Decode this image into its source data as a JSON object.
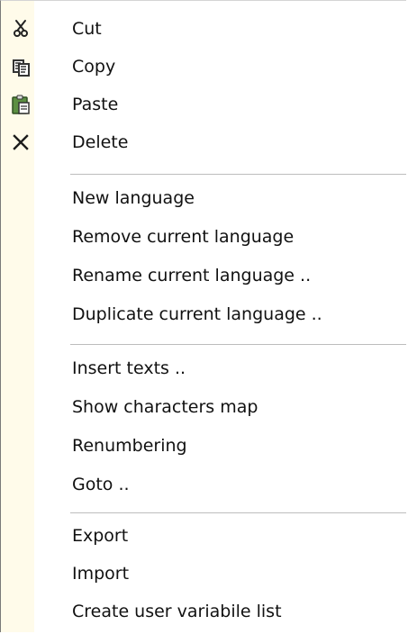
{
  "menu": {
    "groups": [
      {
        "items": [
          {
            "label": "Cut",
            "icon": "scissors-icon"
          },
          {
            "label": "Copy",
            "icon": "copy-icon"
          },
          {
            "label": "Paste",
            "icon": "clipboard-paste-icon"
          },
          {
            "label": "Delete",
            "icon": "x-delete-icon"
          }
        ]
      },
      {
        "items": [
          {
            "label": "New language"
          },
          {
            "label": "Remove current language"
          },
          {
            "label": "Rename current language .."
          },
          {
            "label": "Duplicate current language .."
          }
        ]
      },
      {
        "items": [
          {
            "label": "Insert texts .."
          },
          {
            "label": "Show characters map"
          },
          {
            "label": "Renumbering"
          },
          {
            "label": "Goto .."
          }
        ]
      },
      {
        "items": [
          {
            "label": "Export"
          },
          {
            "label": "Import"
          },
          {
            "label": "Create user variabile list"
          }
        ]
      }
    ],
    "colors": {
      "gutter": "#fffbea",
      "separator": "#bdbdbd",
      "text": "#111111",
      "paste_icon": "#4f7f3a"
    }
  }
}
